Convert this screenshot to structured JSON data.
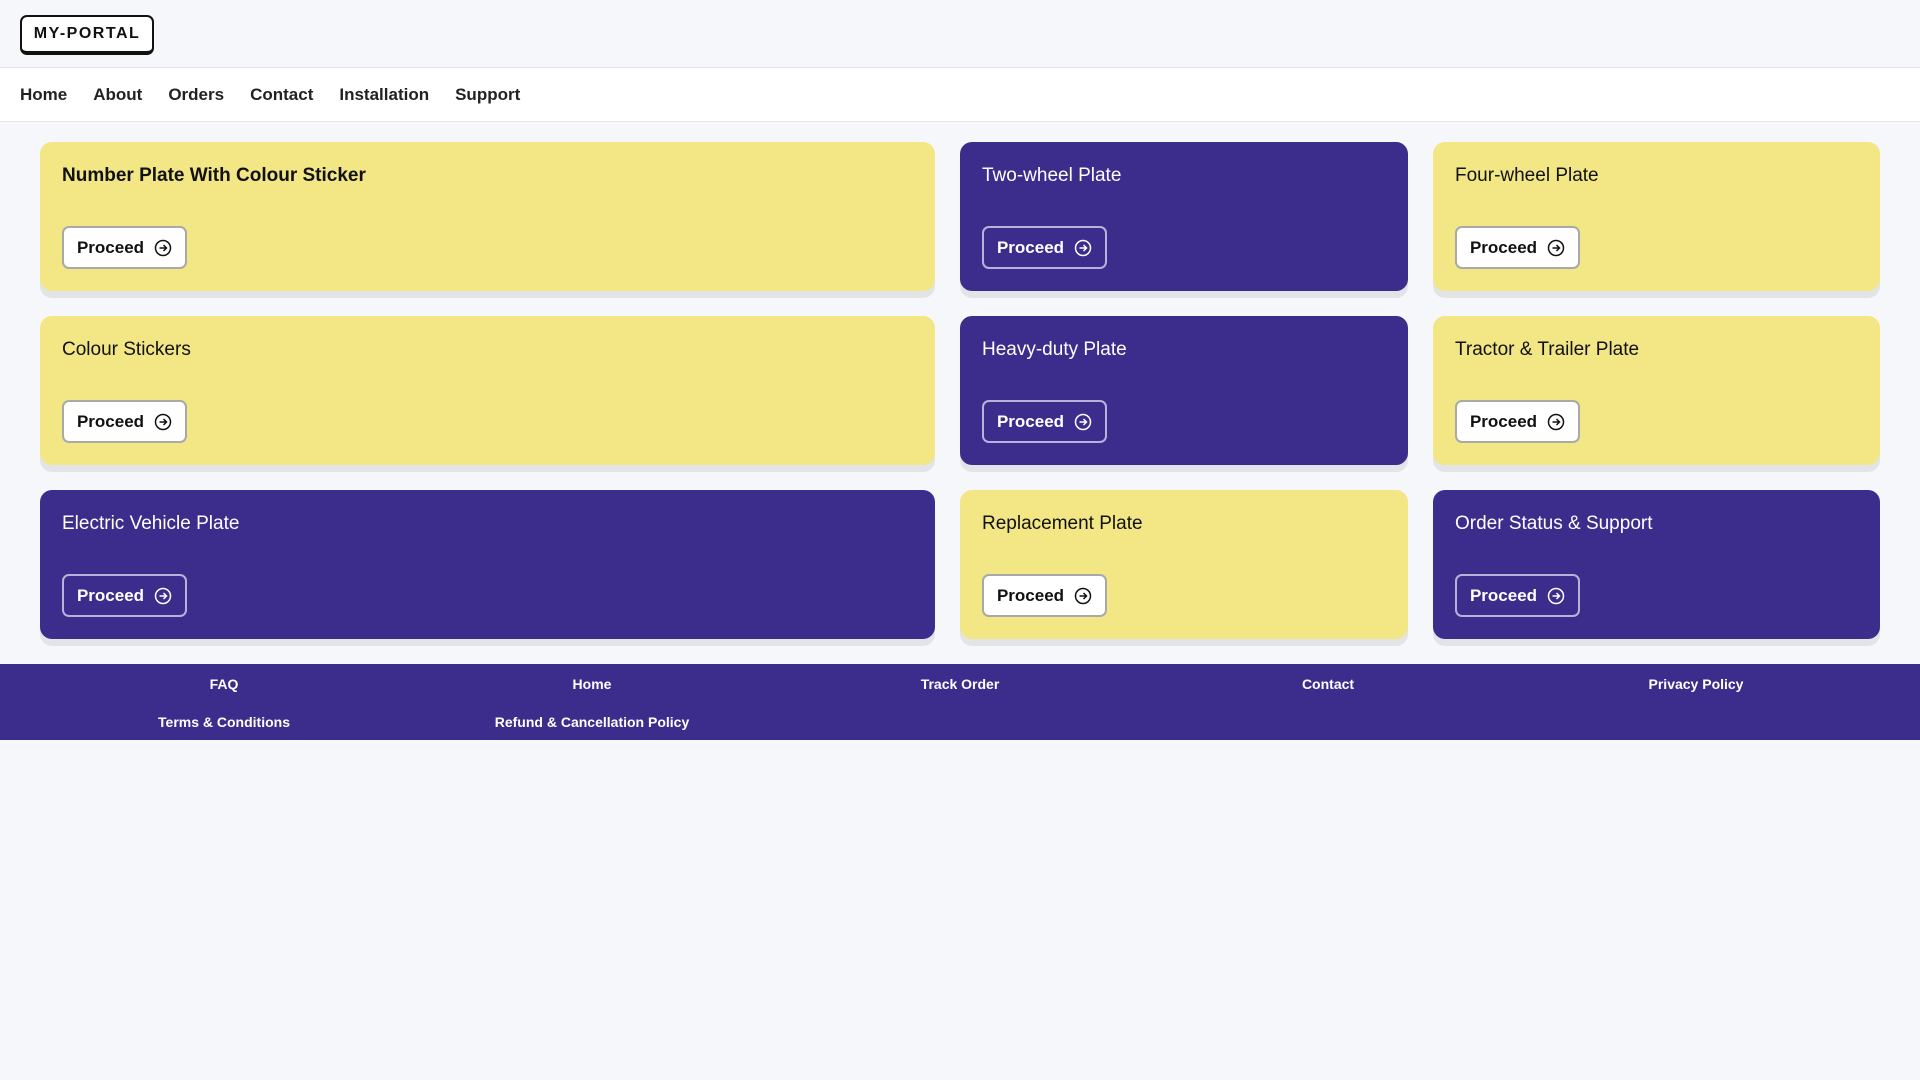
{
  "header": {
    "logo": "MY-PORTAL"
  },
  "nav": [
    "Home",
    "About",
    "Orders",
    "Contact",
    "Installation",
    "Support"
  ],
  "cards": [
    {
      "title": "Number Plate With Colour Sticker",
      "button": "Proceed",
      "theme": "yellow"
    },
    {
      "title": "Two-wheel Plate",
      "button": "Proceed",
      "theme": "purple"
    },
    {
      "title": "Four-wheel Plate",
      "button": "Proceed",
      "theme": "yellow"
    },
    {
      "title": "Colour Stickers",
      "button": "Proceed",
      "theme": "yellow"
    },
    {
      "title": "Heavy-duty Plate",
      "button": "Proceed",
      "theme": "purple"
    },
    {
      "title": "Tractor & Trailer Plate",
      "button": "Proceed",
      "theme": "yellow"
    },
    {
      "title": "Electric Vehicle Plate",
      "button": "Proceed",
      "theme": "purple"
    },
    {
      "title": "Replacement Plate",
      "button": "Proceed",
      "theme": "yellow"
    },
    {
      "title": "Order Status & Support",
      "button": "Proceed",
      "theme": "purple"
    }
  ],
  "footer": [
    "FAQ",
    "Home",
    "Track Order",
    "Contact",
    "Privacy Policy",
    "Terms & Conditions",
    "Refund & Cancellation Policy"
  ],
  "colors": {
    "yellow": "#f2e685",
    "purple": "#3c2d8c",
    "background": "#f6f7fb"
  }
}
